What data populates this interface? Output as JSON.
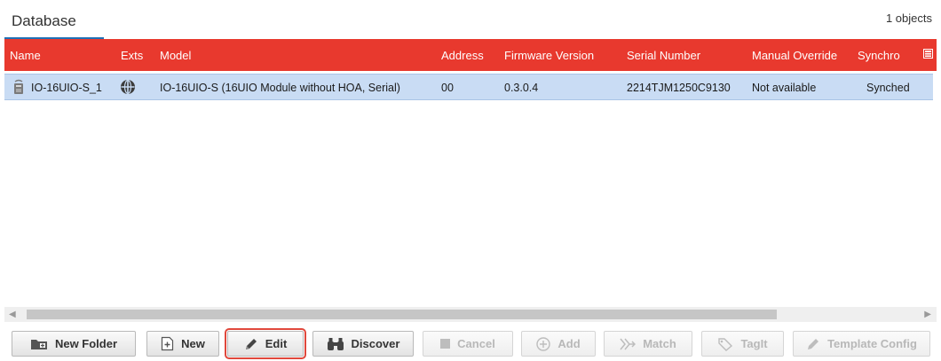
{
  "header": {
    "tab_label": "Database",
    "object_count": "1 objects"
  },
  "table": {
    "columns": [
      "Name",
      "Exts",
      "Model",
      "Address",
      "Firmware Version",
      "Serial Number",
      "Manual Override",
      "Synchro"
    ],
    "rows": [
      {
        "icon": "io-module-icon",
        "ext_icon": "globe-icon",
        "name": "IO-16UIO-S_1",
        "model": "IO-16UIO-S (16UIO Module without HOA, Serial)",
        "address": "00",
        "firmware": "0.3.0.4",
        "serial": "2214TJM1250C9130",
        "override": "Not available",
        "sync": "Synched"
      }
    ]
  },
  "toolbar": {
    "new_folder": "New Folder",
    "new": "New",
    "edit": "Edit",
    "discover": "Discover",
    "cancel": "Cancel",
    "add": "Add",
    "match": "Match",
    "tagit": "TagIt",
    "template_config": "Template Config"
  },
  "colors": {
    "header_bg": "#e8392e",
    "row_selected": "#c9dcf4",
    "focus_outline": "#e0483c"
  }
}
